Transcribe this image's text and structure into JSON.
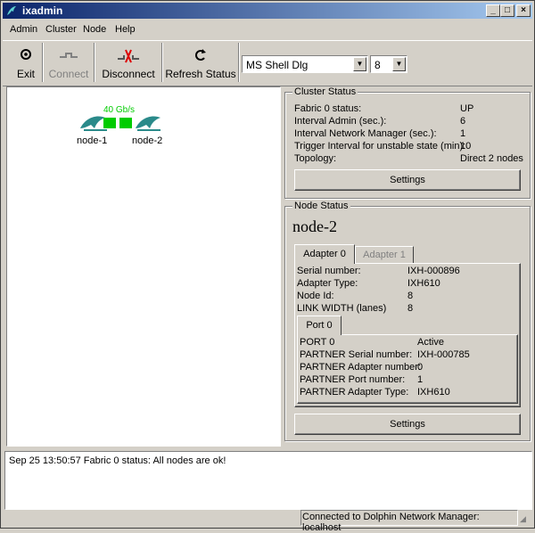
{
  "window": {
    "title": "ixadmin"
  },
  "menu": [
    {
      "label": "Admin"
    },
    {
      "label": "Cluster"
    },
    {
      "label": "Node"
    },
    {
      "label": "Help"
    }
  ],
  "toolbar": {
    "exit": "Exit",
    "connect": "Connect",
    "disconnect": "Disconnect",
    "refresh": "Refresh Status",
    "font_name": "MS Shell Dlg",
    "font_size": "8"
  },
  "topology": {
    "link_speed": "40  Gb/s",
    "node1": "node-1",
    "node2": "node-2"
  },
  "cluster_status": {
    "title": "Cluster Status",
    "rows": [
      {
        "label": "Fabric 0 status:",
        "value": "UP"
      },
      {
        "label": "Interval Admin (sec.):",
        "value": "6"
      },
      {
        "label": "Interval Network Manager (sec.):",
        "value": "1"
      },
      {
        "label": "Trigger Interval for unstable state (min):",
        "value": "10"
      },
      {
        "label": "Topology:",
        "value": "Direct 2 nodes"
      }
    ],
    "settings": "Settings"
  },
  "node_status": {
    "title": "Node Status",
    "node_name": "node-2",
    "tabs": [
      {
        "label": "Adapter 0"
      },
      {
        "label": "Adapter 1"
      }
    ],
    "adapter_rows": [
      {
        "label": "Serial number:",
        "value": "IXH-000896"
      },
      {
        "label": "Adapter Type:",
        "value": "IXH610"
      },
      {
        "label": "Node Id:",
        "value": "8"
      },
      {
        "label": "LINK WIDTH (lanes)",
        "value": "8"
      }
    ],
    "port_tab": "Port 0",
    "port_rows": [
      {
        "label": "PORT 0",
        "value": "Active"
      },
      {
        "label": "PARTNER Serial number:",
        "value": "IXH-000785"
      },
      {
        "label": "PARTNER Adapter number:",
        "value": "0"
      },
      {
        "label": "PARTNER Port number:",
        "value": "1"
      },
      {
        "label": "PARTNER Adapter Type:",
        "value": "IXH610"
      }
    ],
    "settings": "Settings"
  },
  "log": [
    "Sep 25 13:50:57 Fabric 0 status: All nodes are ok!"
  ],
  "status_bar": "Connected to Dolphin Network Manager: localhost",
  "colors": {
    "title_start": "#0a246a",
    "title_end": "#a6caf0",
    "link_green": "#00cc00",
    "dolphin": "#2a8a8a"
  }
}
